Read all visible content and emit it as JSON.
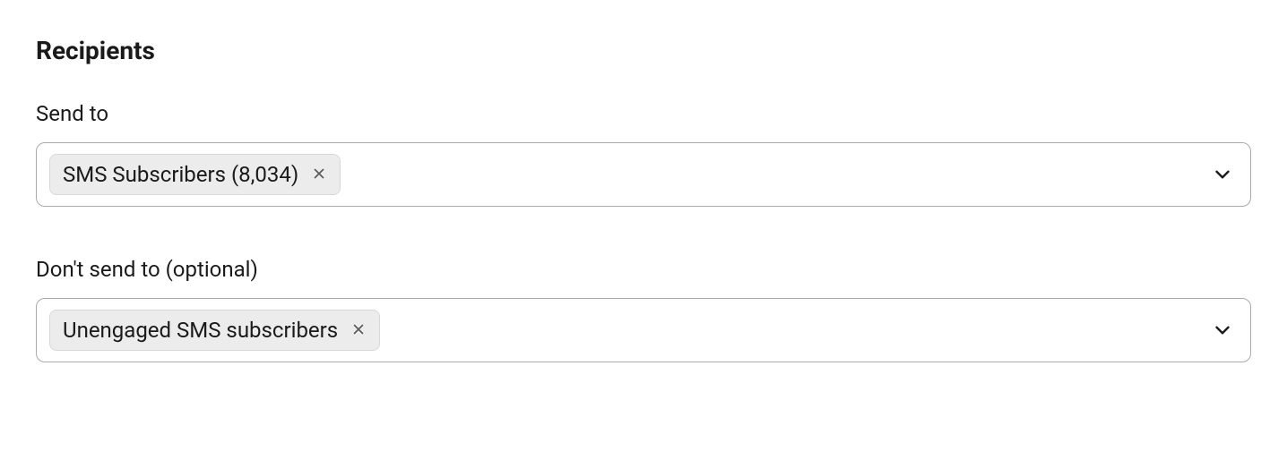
{
  "section": {
    "title": "Recipients"
  },
  "send_to": {
    "label": "Send to",
    "chips": [
      {
        "label": "SMS Subscribers (8,034)"
      }
    ]
  },
  "dont_send_to": {
    "label": "Don't send to (optional)",
    "chips": [
      {
        "label": "Unengaged SMS subscribers"
      }
    ]
  }
}
